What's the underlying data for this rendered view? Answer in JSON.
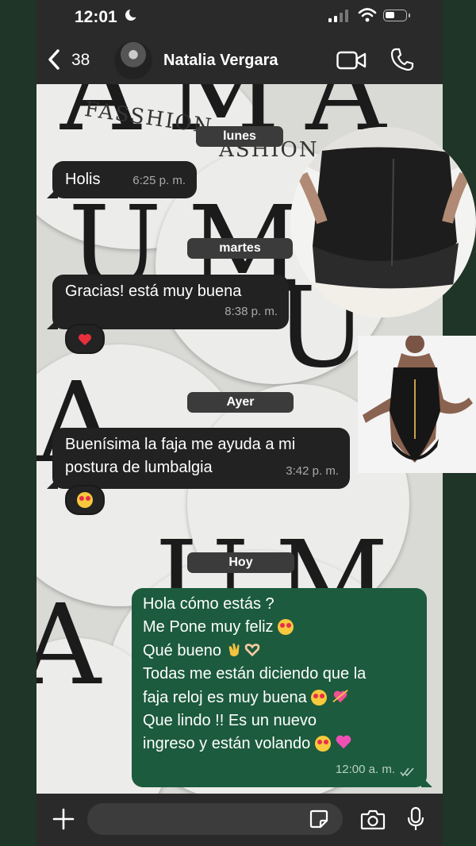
{
  "status": {
    "time": "12:01"
  },
  "header": {
    "unread_count": "38",
    "contact_name": "Natalia Vergara"
  },
  "wallpaper": {
    "brand_text": "FASSHION",
    "brand_text_2": "ASHION"
  },
  "messages": [
    {
      "type": "date",
      "label": "lunes"
    },
    {
      "type": "in",
      "text": "Holis",
      "time": "6:25 p. m."
    },
    {
      "type": "date",
      "label": "martes"
    },
    {
      "type": "in",
      "text": "Gracias! está muy buena",
      "time": "8:38 p. m.",
      "reaction": "heart"
    },
    {
      "type": "date",
      "label": "Ayer"
    },
    {
      "type": "in",
      "text_line1": "Buenísima la faja me ayuda a mi",
      "text_line2": "postura de lumbalgia",
      "time": "3:42 p. m.",
      "reaction": "heart-eyes"
    },
    {
      "type": "date",
      "label": "Hoy"
    },
    {
      "type": "out",
      "lines": [
        "Hola cómo estás ?",
        "Me Pone muy feliz",
        "Qué bueno",
        "Todas me están diciendo que la",
        "faja reloj es muy buena",
        "Que lindo !! Es un nuevo",
        "ingreso y están volando"
      ],
      "time": "12:00 a. m."
    }
  ],
  "colors": {
    "incoming": "#222222",
    "outgoing": "#1c5b3d",
    "background": "#1f3527"
  },
  "icons": [
    "moon-icon",
    "signal-icon",
    "wifi-icon",
    "battery-icon",
    "back-chevron-icon",
    "video-call-icon",
    "phone-call-icon",
    "plus-icon",
    "sticker-icon",
    "camera-icon",
    "microphone-icon",
    "double-check-icon"
  ]
}
